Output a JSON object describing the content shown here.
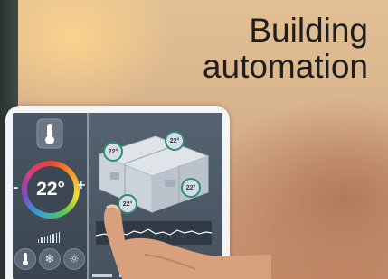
{
  "title": {
    "line1": "Building",
    "line2": "automation"
  },
  "thermostat": {
    "temperature": "22°",
    "decrease_symbol": "-",
    "increase_symbol": "+"
  },
  "room_markers": [
    "22°",
    "22°",
    "22°",
    "22°"
  ],
  "colors": {
    "title_text": "#1e1e1e",
    "screen_background": "#3e4a57"
  }
}
